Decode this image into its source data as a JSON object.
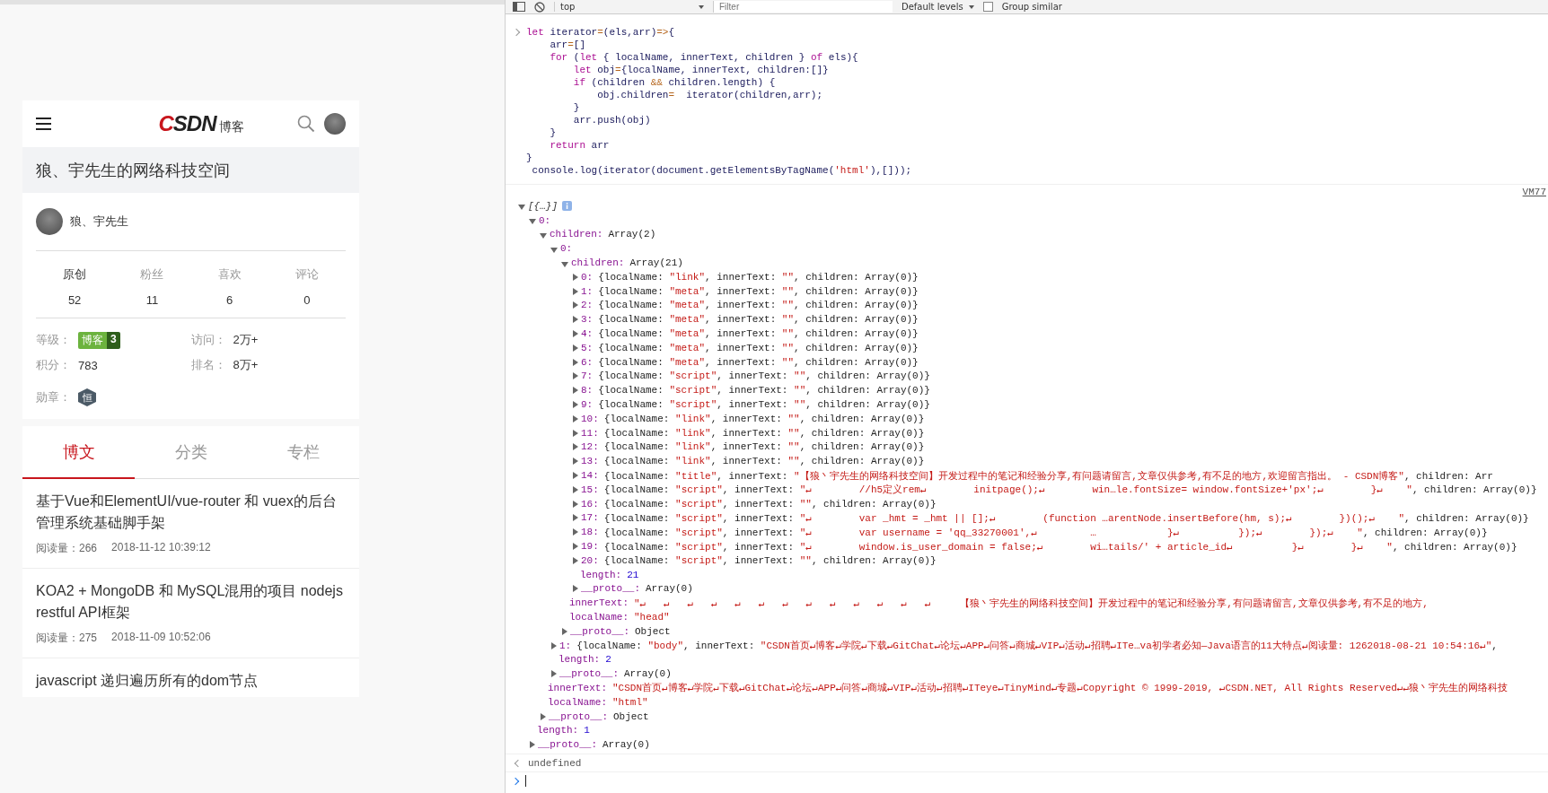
{
  "page": {
    "header": {
      "logo": "CSDN",
      "logo_suffix": "博客"
    },
    "blog_title": "狼、宇先生的网络科技空间",
    "profile": {
      "name": "狼、宇先生"
    },
    "stats": [
      {
        "label": "原创",
        "value": "52",
        "selected": true
      },
      {
        "label": "粉丝",
        "value": "11",
        "selected": false
      },
      {
        "label": "喜欢",
        "value": "6",
        "selected": false
      },
      {
        "label": "评论",
        "value": "0",
        "selected": false
      }
    ],
    "info": [
      {
        "kind": "badge",
        "label": "等级：",
        "badge_text": "博客",
        "badge_number": "3"
      },
      {
        "kind": "text",
        "label": "访问：",
        "value": "2万+"
      },
      {
        "kind": "text",
        "label": "积分：",
        "value": "783"
      },
      {
        "kind": "text",
        "label": "排名：",
        "value": "8万+"
      },
      {
        "kind": "medal",
        "label": "勋章：",
        "medal": "恒"
      }
    ],
    "tabs": [
      {
        "label": "博文",
        "selected": true
      },
      {
        "label": "分类",
        "selected": false
      },
      {
        "label": "专栏",
        "selected": false
      }
    ],
    "articles": [
      {
        "title": "基于Vue和ElementUI/vue-router 和 vuex的后台管理系统基础脚手架",
        "reads": "阅读量：266",
        "date": "2018-11-12 10:39:12"
      },
      {
        "title": "KOA2 + MongoDB 和 MySQL混用的项目 nodejs restful API框架",
        "reads": "阅读量：275",
        "date": "2018-11-09 10:52:06"
      },
      {
        "title": "javascript 递归遍历所有的dom节点"
      }
    ]
  },
  "devtools": {
    "toolbar": {
      "context": "top",
      "filter_placeholder": "Filter",
      "levels": "Default levels",
      "group_similar": {
        "label": "Group similar",
        "checked": false
      }
    },
    "code": [
      [
        {
          "kind": "keyword",
          "t": "let "
        },
        {
          "kind": "identifier",
          "t": "iterator"
        },
        {
          "kind": "operator",
          "t": "="
        },
        {
          "kind": "identifier",
          "t": "(els,arr)"
        },
        {
          "kind": "operator",
          "t": "=>"
        },
        {
          "kind": "identifier",
          "t": "{"
        }
      ],
      [
        {
          "kind": "identifier",
          "t": "    arr"
        },
        {
          "kind": "operator",
          "t": "="
        },
        {
          "kind": "identifier",
          "t": "[]"
        }
      ],
      [
        {
          "kind": "keyword",
          "t": "    for"
        },
        {
          "kind": "identifier",
          "t": " ("
        },
        {
          "kind": "keyword",
          "t": "let"
        },
        {
          "kind": "identifier",
          "t": " { localName, innerText, children } "
        },
        {
          "kind": "keyword",
          "t": "of"
        },
        {
          "kind": "identifier",
          "t": " els){"
        }
      ],
      [
        {
          "kind": "keyword",
          "t": "        let"
        },
        {
          "kind": "identifier",
          "t": " obj"
        },
        {
          "kind": "operator",
          "t": "="
        },
        {
          "kind": "identifier",
          "t": "{localName, innerText, children:[]}"
        }
      ],
      [
        {
          "kind": "keyword",
          "t": "        if"
        },
        {
          "kind": "identifier",
          "t": " (children "
        },
        {
          "kind": "operator",
          "t": "&&"
        },
        {
          "kind": "identifier",
          "t": " children.length) {"
        }
      ],
      [
        {
          "kind": "identifier",
          "t": "            obj.children"
        },
        {
          "kind": "operator",
          "t": "="
        },
        {
          "kind": "identifier",
          "t": "  iterator(children,arr);"
        }
      ],
      [
        {
          "kind": "identifier",
          "t": "        }"
        }
      ],
      [
        {
          "kind": "identifier",
          "t": "        arr.push(obj)"
        }
      ],
      [
        {
          "kind": "identifier",
          "t": "    }"
        }
      ],
      [
        {
          "kind": "keyword",
          "t": "    return"
        },
        {
          "kind": "identifier",
          "t": " arr"
        }
      ],
      [
        {
          "kind": "identifier",
          "t": "}"
        }
      ],
      [
        {
          "kind": "identifier",
          "t": " console.log(iterator(document.getElementsByTagName("
        },
        {
          "kind": "string",
          "t": "'html'"
        },
        {
          "kind": "identifier",
          "t": "),[]));"
        }
      ]
    ],
    "source_link": "VM77",
    "output": [
      {
        "summary": "[{…}]",
        "expanded": true,
        "children": [
          {
            "key": "0:",
            "expanded": true,
            "children": [
              {
                "key": "children:",
                "value": [
                  {
                    "kind": "plain",
                    "t": "Array(2)"
                  }
                ],
                "expanded": true,
                "children": [
                  {
                    "key": "0:",
                    "expanded": true,
                    "children": [
                      {
                        "key": "children:",
                        "value": [
                          {
                            "kind": "plain",
                            "t": "Array(21)"
                          }
                        ],
                        "expanded": true,
                        "children": [
                          {
                            "key": "0:",
                            "value": [
                              {
                                "kind": "plain",
                                "t": "{localName: "
                              },
                              {
                                "kind": "string",
                                "t": "\"link\""
                              },
                              {
                                "kind": "plain",
                                "t": ", innerText: "
                              },
                              {
                                "kind": "string",
                                "t": "\"\""
                              },
                              {
                                "kind": "plain",
                                "t": ", children: Array(0)}"
                              }
                            ],
                            "expanded": false
                          },
                          {
                            "key": "1:",
                            "value": [
                              {
                                "kind": "plain",
                                "t": "{localName: "
                              },
                              {
                                "kind": "string",
                                "t": "\"meta\""
                              },
                              {
                                "kind": "plain",
                                "t": ", innerText: "
                              },
                              {
                                "kind": "string",
                                "t": "\"\""
                              },
                              {
                                "kind": "plain",
                                "t": ", children: Array(0)}"
                              }
                            ],
                            "expanded": false
                          },
                          {
                            "key": "2:",
                            "value": [
                              {
                                "kind": "plain",
                                "t": "{localName: "
                              },
                              {
                                "kind": "string",
                                "t": "\"meta\""
                              },
                              {
                                "kind": "plain",
                                "t": ", innerText: "
                              },
                              {
                                "kind": "string",
                                "t": "\"\""
                              },
                              {
                                "kind": "plain",
                                "t": ", children: Array(0)}"
                              }
                            ],
                            "expanded": false
                          },
                          {
                            "key": "3:",
                            "value": [
                              {
                                "kind": "plain",
                                "t": "{localName: "
                              },
                              {
                                "kind": "string",
                                "t": "\"meta\""
                              },
                              {
                                "kind": "plain",
                                "t": ", innerText: "
                              },
                              {
                                "kind": "string",
                                "t": "\"\""
                              },
                              {
                                "kind": "plain",
                                "t": ", children: Array(0)}"
                              }
                            ],
                            "expanded": false
                          },
                          {
                            "key": "4:",
                            "value": [
                              {
                                "kind": "plain",
                                "t": "{localName: "
                              },
                              {
                                "kind": "string",
                                "t": "\"meta\""
                              },
                              {
                                "kind": "plain",
                                "t": ", innerText: "
                              },
                              {
                                "kind": "string",
                                "t": "\"\""
                              },
                              {
                                "kind": "plain",
                                "t": ", children: Array(0)}"
                              }
                            ],
                            "expanded": false
                          },
                          {
                            "key": "5:",
                            "value": [
                              {
                                "kind": "plain",
                                "t": "{localName: "
                              },
                              {
                                "kind": "string",
                                "t": "\"meta\""
                              },
                              {
                                "kind": "plain",
                                "t": ", innerText: "
                              },
                              {
                                "kind": "string",
                                "t": "\"\""
                              },
                              {
                                "kind": "plain",
                                "t": ", children: Array(0)}"
                              }
                            ],
                            "expanded": false
                          },
                          {
                            "key": "6:",
                            "value": [
                              {
                                "kind": "plain",
                                "t": "{localName: "
                              },
                              {
                                "kind": "string",
                                "t": "\"meta\""
                              },
                              {
                                "kind": "plain",
                                "t": ", innerText: "
                              },
                              {
                                "kind": "string",
                                "t": "\"\""
                              },
                              {
                                "kind": "plain",
                                "t": ", children: Array(0)}"
                              }
                            ],
                            "expanded": false
                          },
                          {
                            "key": "7:",
                            "value": [
                              {
                                "kind": "plain",
                                "t": "{localName: "
                              },
                              {
                                "kind": "string",
                                "t": "\"script\""
                              },
                              {
                                "kind": "plain",
                                "t": ", innerText: "
                              },
                              {
                                "kind": "string",
                                "t": "\"\""
                              },
                              {
                                "kind": "plain",
                                "t": ", children: Array(0)}"
                              }
                            ],
                            "expanded": false
                          },
                          {
                            "key": "8:",
                            "value": [
                              {
                                "kind": "plain",
                                "t": "{localName: "
                              },
                              {
                                "kind": "string",
                                "t": "\"script\""
                              },
                              {
                                "kind": "plain",
                                "t": ", innerText: "
                              },
                              {
                                "kind": "string",
                                "t": "\"\""
                              },
                              {
                                "kind": "plain",
                                "t": ", children: Array(0)}"
                              }
                            ],
                            "expanded": false
                          },
                          {
                            "key": "9:",
                            "value": [
                              {
                                "kind": "plain",
                                "t": "{localName: "
                              },
                              {
                                "kind": "string",
                                "t": "\"script\""
                              },
                              {
                                "kind": "plain",
                                "t": ", innerText: "
                              },
                              {
                                "kind": "string",
                                "t": "\"\""
                              },
                              {
                                "kind": "plain",
                                "t": ", children: Array(0)}"
                              }
                            ],
                            "expanded": false
                          },
                          {
                            "key": "10:",
                            "value": [
                              {
                                "kind": "plain",
                                "t": "{localName: "
                              },
                              {
                                "kind": "string",
                                "t": "\"link\""
                              },
                              {
                                "kind": "plain",
                                "t": ", innerText: "
                              },
                              {
                                "kind": "string",
                                "t": "\"\""
                              },
                              {
                                "kind": "plain",
                                "t": ", children: Array(0)}"
                              }
                            ],
                            "expanded": false
                          },
                          {
                            "key": "11:",
                            "value": [
                              {
                                "kind": "plain",
                                "t": "{localName: "
                              },
                              {
                                "kind": "string",
                                "t": "\"link\""
                              },
                              {
                                "kind": "plain",
                                "t": ", innerText: "
                              },
                              {
                                "kind": "string",
                                "t": "\"\""
                              },
                              {
                                "kind": "plain",
                                "t": ", children: Array(0)}"
                              }
                            ],
                            "expanded": false
                          },
                          {
                            "key": "12:",
                            "value": [
                              {
                                "kind": "plain",
                                "t": "{localName: "
                              },
                              {
                                "kind": "string",
                                "t": "\"link\""
                              },
                              {
                                "kind": "plain",
                                "t": ", innerText: "
                              },
                              {
                                "kind": "string",
                                "t": "\"\""
                              },
                              {
                                "kind": "plain",
                                "t": ", children: Array(0)}"
                              }
                            ],
                            "expanded": false
                          },
                          {
                            "key": "13:",
                            "value": [
                              {
                                "kind": "plain",
                                "t": "{localName: "
                              },
                              {
                                "kind": "string",
                                "t": "\"link\""
                              },
                              {
                                "kind": "plain",
                                "t": ", innerText: "
                              },
                              {
                                "kind": "string",
                                "t": "\"\""
                              },
                              {
                                "kind": "plain",
                                "t": ", children: Array(0)}"
                              }
                            ],
                            "expanded": false
                          },
                          {
                            "key": "14:",
                            "value": [
                              {
                                "kind": "plain",
                                "t": "{localName: "
                              },
                              {
                                "kind": "string",
                                "t": "\"title\""
                              },
                              {
                                "kind": "plain",
                                "t": ", innerText: "
                              },
                              {
                                "kind": "string",
                                "t": "\"【狼丶宇先生的网络科技空间】开发过程中的笔记和经验分享,有问题请留言,文章仅供参考,有不足的地方,欢迎留言指出。 - CSDN博客\""
                              },
                              {
                                "kind": "plain",
                                "t": ", children: Arr"
                              }
                            ],
                            "expanded": false
                          },
                          {
                            "key": "15:",
                            "value": [
                              {
                                "kind": "plain",
                                "t": "{localName: "
                              },
                              {
                                "kind": "string",
                                "t": "\"script\""
                              },
                              {
                                "kind": "plain",
                                "t": ", innerText: "
                              },
                              {
                                "kind": "string",
                                "t": "\"↵        //h5定义rem↵        initpage();↵        win…le.fontSize= window.fontSize+'px';↵        }↵    \""
                              },
                              {
                                "kind": "plain",
                                "t": ", children: Array(0)}"
                              }
                            ],
                            "expanded": false
                          },
                          {
                            "key": "16:",
                            "value": [
                              {
                                "kind": "plain",
                                "t": "{localName: "
                              },
                              {
                                "kind": "string",
                                "t": "\"script\""
                              },
                              {
                                "kind": "plain",
                                "t": ", innerText: "
                              },
                              {
                                "kind": "string",
                                "t": "\"\""
                              },
                              {
                                "kind": "plain",
                                "t": ", children: Array(0)}"
                              }
                            ],
                            "expanded": false
                          },
                          {
                            "key": "17:",
                            "value": [
                              {
                                "kind": "plain",
                                "t": "{localName: "
                              },
                              {
                                "kind": "string",
                                "t": "\"script\""
                              },
                              {
                                "kind": "plain",
                                "t": ", innerText: "
                              },
                              {
                                "kind": "string",
                                "t": "\"↵        var _hmt = _hmt || [];↵        (function …arentNode.insertBefore(hm, s);↵        })();↵    \""
                              },
                              {
                                "kind": "plain",
                                "t": ", children: Array(0)}"
                              }
                            ],
                            "expanded": false
                          },
                          {
                            "key": "18:",
                            "value": [
                              {
                                "kind": "plain",
                                "t": "{localName: "
                              },
                              {
                                "kind": "string",
                                "t": "\"script\""
                              },
                              {
                                "kind": "plain",
                                "t": ", innerText: "
                              },
                              {
                                "kind": "string",
                                "t": "\"↵        var username = 'qq_33270001',↵         …            }↵          });↵        });↵    \""
                              },
                              {
                                "kind": "plain",
                                "t": ", children: Array(0)}"
                              }
                            ],
                            "expanded": false
                          },
                          {
                            "key": "19:",
                            "value": [
                              {
                                "kind": "plain",
                                "t": "{localName: "
                              },
                              {
                                "kind": "string",
                                "t": "\"script\""
                              },
                              {
                                "kind": "plain",
                                "t": ", innerText: "
                              },
                              {
                                "kind": "string",
                                "t": "\"↵        window.is_user_domain = false;↵        wi…tails/' + article_id↵          }↵        }↵    \""
                              },
                              {
                                "kind": "plain",
                                "t": ", children: Array(0)}"
                              }
                            ],
                            "expanded": false
                          },
                          {
                            "key": "20:",
                            "value": [
                              {
                                "kind": "plain",
                                "t": "{localName: "
                              },
                              {
                                "kind": "string",
                                "t": "\"script\""
                              },
                              {
                                "kind": "plain",
                                "t": ", innerText: "
                              },
                              {
                                "kind": "string",
                                "t": "\"\""
                              },
                              {
                                "kind": "plain",
                                "t": ", children: Array(0)}"
                              }
                            ],
                            "expanded": false
                          },
                          {
                            "key": "length:",
                            "value": [
                              {
                                "kind": "number",
                                "t": "21"
                              }
                            ]
                          },
                          {
                            "key": "__proto__:",
                            "value": [
                              {
                                "kind": "plain",
                                "t": "Array(0)"
                              }
                            ],
                            "expanded": false
                          }
                        ]
                      },
                      {
                        "key": "innerText:",
                        "value": [
                          {
                            "kind": "string",
                            "t": "\"↵   ↵   ↵   ↵   ↵   ↵   ↵   ↵   ↵   ↵   ↵   ↵   ↵     【狼丶宇先生的网络科技空间】开发过程中的笔记和经验分享,有问题请留言,文章仅供参考,有不足的地方,"
                          }
                        ]
                      },
                      {
                        "key": "localName:",
                        "value": [
                          {
                            "kind": "string",
                            "t": "\"head\""
                          }
                        ]
                      },
                      {
                        "key": "__proto__:",
                        "value": [
                          {
                            "kind": "plain",
                            "t": "Object"
                          }
                        ],
                        "expanded": false
                      }
                    ]
                  },
                  {
                    "key": "1:",
                    "value": [
                      {
                        "kind": "plain",
                        "t": "{localName: "
                      },
                      {
                        "kind": "string",
                        "t": "\"body\""
                      },
                      {
                        "kind": "plain",
                        "t": ", innerText: "
                      },
                      {
                        "kind": "string",
                        "t": "\"CSDN首页↵博客↵学院↵下载↵GitChat↵论坛↵APP↵问答↵商城↵VIP↵活动↵招聘↵ITe…va初学者必知—Java语言的11大特点↵阅读量: 1262018-08-21 10:54:16↵\""
                      },
                      {
                        "kind": "plain",
                        "t": ","
                      }
                    ],
                    "expanded": false
                  },
                  {
                    "key": "length:",
                    "value": [
                      {
                        "kind": "number",
                        "t": "2"
                      }
                    ]
                  },
                  {
                    "key": "__proto__:",
                    "value": [
                      {
                        "kind": "plain",
                        "t": "Array(0)"
                      }
                    ],
                    "expanded": false
                  }
                ]
              },
              {
                "key": "innerText:",
                "value": [
                  {
                    "kind": "string",
                    "t": "\"CSDN首页↵博客↵学院↵下载↵GitChat↵论坛↵APP↵问答↵商城↵VIP↵活动↵招聘↵ITeye↵TinyMind↵专题↵Copyright © 1999-2019, ↵CSDN.NET, All Rights Reserved↵↵狼丶宇先生的网络科技"
                  }
                ]
              },
              {
                "key": "localName:",
                "value": [
                  {
                    "kind": "string",
                    "t": "\"html\""
                  }
                ]
              },
              {
                "key": "__proto__:",
                "value": [
                  {
                    "kind": "plain",
                    "t": "Object"
                  }
                ],
                "expanded": false
              }
            ]
          },
          {
            "key": "length:",
            "value": [
              {
                "kind": "number",
                "t": "1"
              }
            ]
          },
          {
            "key": "__proto__:",
            "value": [
              {
                "kind": "plain",
                "t": "Array(0)"
              }
            ],
            "expanded": false
          }
        ]
      }
    ],
    "result": "undefined"
  }
}
